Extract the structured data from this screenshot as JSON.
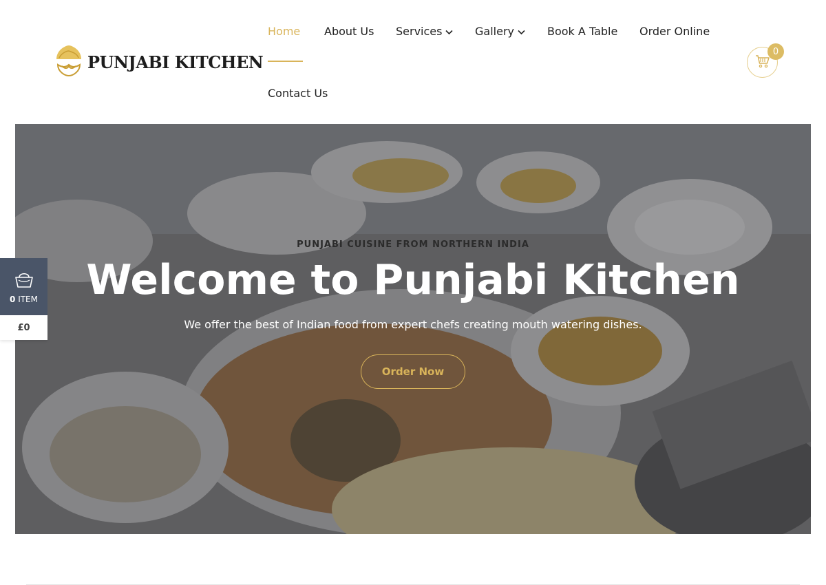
{
  "header": {
    "logo_text": "PUNJABI KITCHEN",
    "nav": [
      {
        "label": "Home",
        "active": true
      },
      {
        "label": "About Us"
      },
      {
        "label": "Services",
        "dropdown": true
      },
      {
        "label": "Gallery",
        "dropdown": true
      },
      {
        "label": "Book A Table"
      },
      {
        "label": "Order Online"
      },
      {
        "label": "Contact Us"
      }
    ],
    "cart_count": "0"
  },
  "hero": {
    "subtitle": "PUNJABI CUISINE FROM NORTHERN INDIA",
    "title": "Welcome to Punjabi Kitchen",
    "description": "We offer the best of Indian food from expert chefs creating mouth watering dishes.",
    "cta_label": "Order Now"
  },
  "side_cart": {
    "count": "0",
    "items_label": "ITEM",
    "total": "£0"
  },
  "colors": {
    "accent": "#d9b45a",
    "side_cart_bg": "#4a5568"
  },
  "icons": [
    "chef-turban-logo-icon",
    "chevron-down-icon",
    "cart-icon",
    "basket-icon"
  ]
}
